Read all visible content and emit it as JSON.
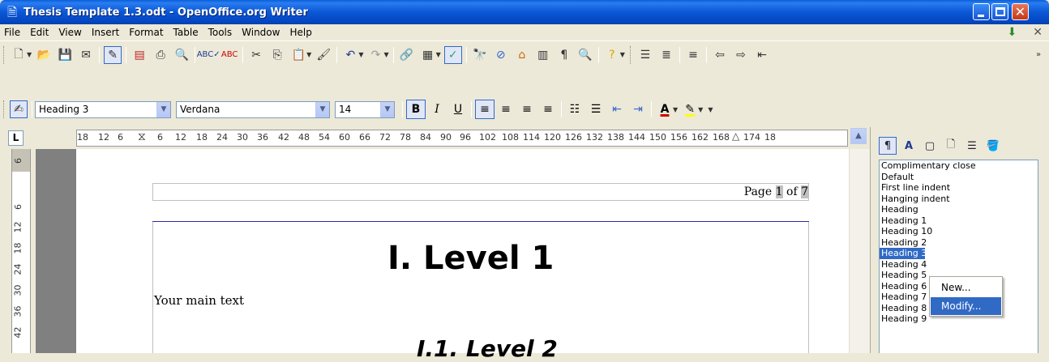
{
  "window": {
    "title": "Thesis Template 1.3.odt - OpenOffice.org Writer",
    "app_icon": "writer-document-icon"
  },
  "menubar": {
    "items": [
      "File",
      "Edit",
      "View",
      "Insert",
      "Format",
      "Table",
      "Tools",
      "Window",
      "Help"
    ]
  },
  "formatting": {
    "paragraph_style": "Heading 3",
    "font_name": "Verdana",
    "font_size": "14"
  },
  "ruler": {
    "ticks": [
      "18",
      "12",
      "6",
      "6",
      "12",
      "18",
      "24",
      "30",
      "36",
      "42",
      "48",
      "54",
      "60",
      "66",
      "72",
      "78",
      "84",
      "90",
      "96",
      "102",
      "108",
      "114",
      "120",
      "126",
      "132",
      "138",
      "144",
      "150",
      "156",
      "162",
      "168",
      "174",
      "18"
    ],
    "vertical_ticks": [
      "6",
      "6",
      "12",
      "18",
      "24",
      "30",
      "36",
      "42"
    ],
    "tab_button": "L"
  },
  "document": {
    "header_page_prefix": "Page ",
    "header_page_current": "1",
    "header_page_of": " of ",
    "header_page_total": "7",
    "heading1": "I. Level 1",
    "main_text": "Your main text",
    "heading2": "I.1. Level 2"
  },
  "styles_panel": {
    "styles": [
      "Complimentary close",
      "Default",
      "First line indent",
      "Hanging indent",
      "Heading",
      "Heading 1",
      "Heading 10",
      "Heading 2",
      "Heading 3",
      "Heading 4",
      "Heading 5",
      "Heading 6",
      "Heading 7",
      "Heading 8",
      "Heading 9"
    ],
    "selected_index": 8
  },
  "context_menu": {
    "new_label": "New...",
    "modify_label": "Modify..."
  },
  "colors": {
    "titlebar": "#0a57d6",
    "selection": "#316ac5",
    "chrome": "#ece9d8"
  }
}
